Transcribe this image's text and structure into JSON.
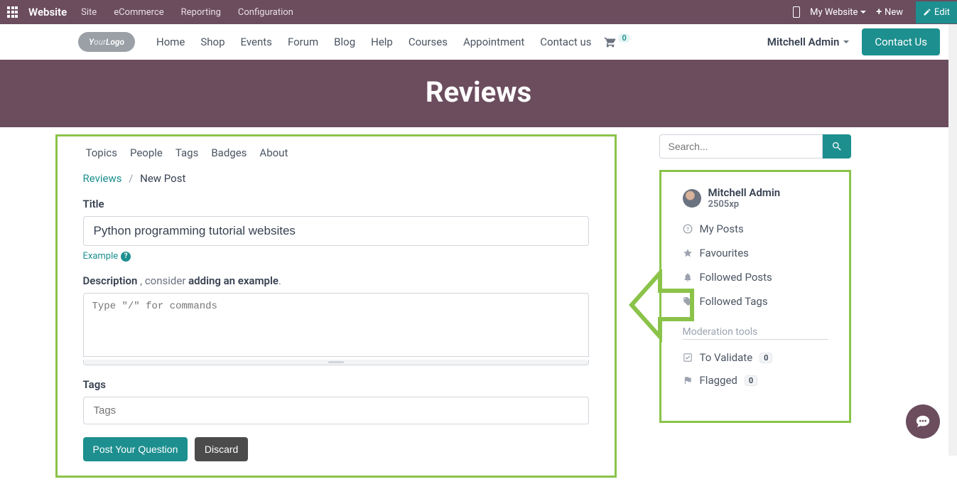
{
  "admin": {
    "brand": "Website",
    "menu": [
      "Site",
      "eCommerce",
      "Reporting",
      "Configuration"
    ],
    "my_website": "My Website",
    "new": "New",
    "edit": "Edit"
  },
  "nav": {
    "logo_text": "YourLogo",
    "links": [
      "Home",
      "Shop",
      "Events",
      "Forum",
      "Blog",
      "Help",
      "Courses",
      "Appointment",
      "Contact us"
    ],
    "cart_count": "0",
    "user": "Mitchell Admin",
    "contact": "Contact Us"
  },
  "banner": {
    "title": "Reviews"
  },
  "forum_nav": [
    "Topics",
    "People",
    "Tags",
    "Badges",
    "About"
  ],
  "breadcrumb": {
    "root": "Reviews",
    "current": "New Post"
  },
  "form": {
    "title_label": "Title",
    "title_value": "Python programming tutorial websites",
    "example": "Example",
    "desc_label": "Description",
    "desc_hint_prefix": ", consider ",
    "desc_hint_strong": "adding an example",
    "desc_hint_suffix": ".",
    "desc_placeholder": "Type \"/\" for commands",
    "tags_label": "Tags",
    "tags_placeholder": "Tags",
    "submit": "Post Your Question",
    "discard": "Discard"
  },
  "search": {
    "placeholder": "Search..."
  },
  "sidebar": {
    "user": {
      "name": "Mitchell Admin",
      "xp": "2505xp"
    },
    "links": [
      "My Posts",
      "Favourites",
      "Followed Posts",
      "Followed Tags"
    ],
    "mod_title": "Moderation tools",
    "to_validate": "To Validate",
    "to_validate_count": "0",
    "flagged": "Flagged",
    "flagged_count": "0"
  }
}
